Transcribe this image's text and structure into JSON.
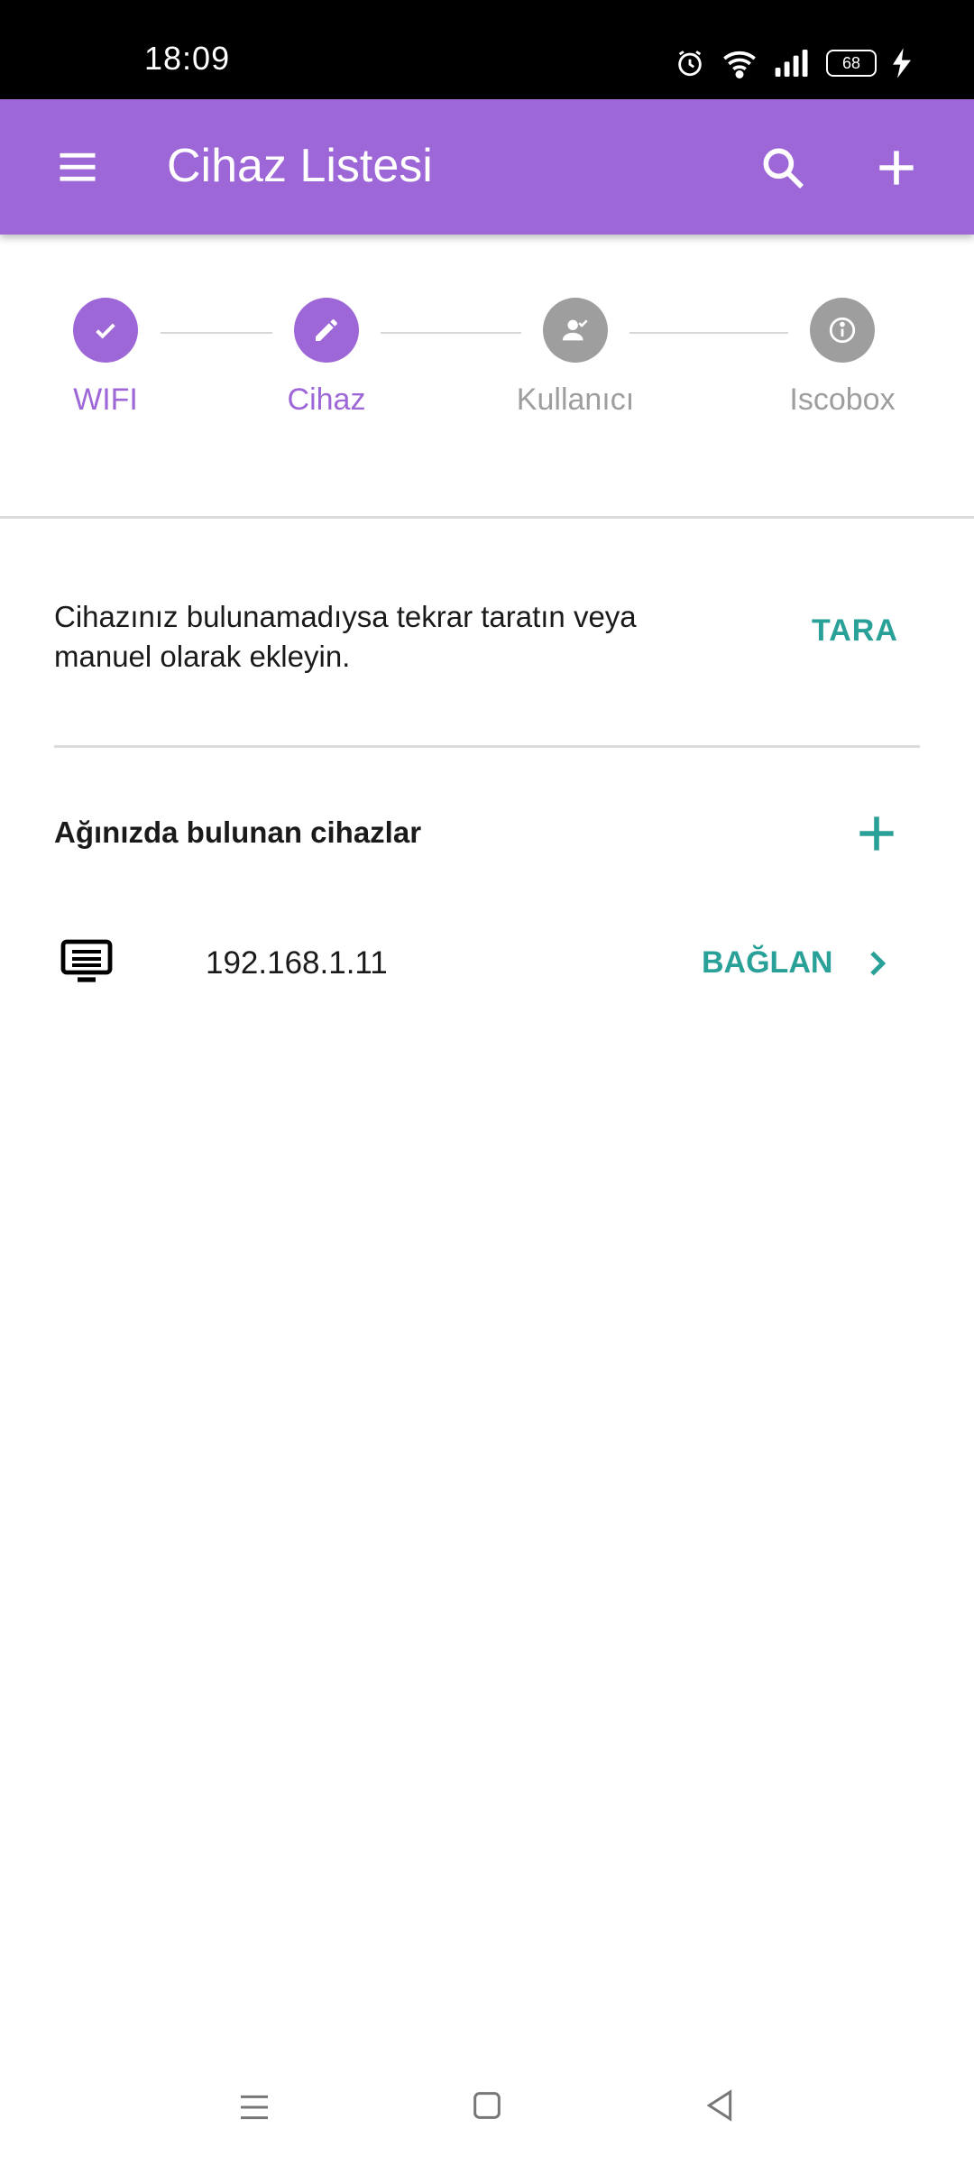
{
  "status_bar": {
    "time": "18:09",
    "battery_level": "68",
    "icons": [
      "alarm-icon",
      "wifi-icon",
      "signal-icon",
      "battery-icon",
      "charging-icon"
    ]
  },
  "app_bar": {
    "title": "Cihaz Listesi",
    "background_color": "#9e67d7",
    "icons": [
      "menu-icon",
      "search-icon",
      "add-icon"
    ]
  },
  "stepper": {
    "steps": [
      {
        "label": "WIFI",
        "icon": "check-icon",
        "state": "active"
      },
      {
        "label": "Cihaz",
        "icon": "pencil-icon",
        "state": "active"
      },
      {
        "label": "Kullanıcı",
        "icon": "user-check-icon",
        "state": "inactive"
      },
      {
        "label": "Iscobox",
        "icon": "info-icon",
        "state": "inactive"
      }
    ],
    "active_color": "#9e67d7",
    "inactive_color": "#9e9e9e"
  },
  "info": {
    "message_line1": "Cihazınız bulunamadıysa tekrar taratın veya",
    "message_line2": "manuel olarak ekleyin.",
    "scan_label": "TARA"
  },
  "devices": {
    "title": "Ağınızda bulunan cihazlar",
    "items": [
      {
        "ip": "192.168.1.11",
        "action_label": "BAĞLAN",
        "icon": "device-icon"
      }
    ]
  },
  "accent_color": "#2aa198"
}
